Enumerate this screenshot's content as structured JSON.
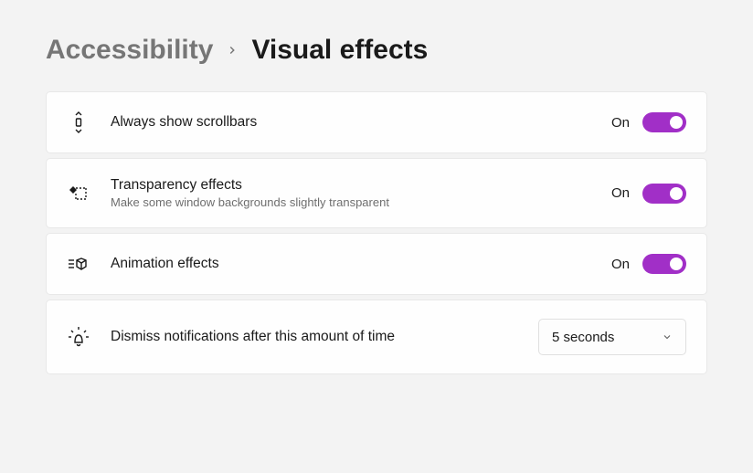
{
  "breadcrumb": {
    "parent": "Accessibility",
    "current": "Visual effects"
  },
  "settings": {
    "scrollbars": {
      "title": "Always show scrollbars",
      "state_label": "On"
    },
    "transparency": {
      "title": "Transparency effects",
      "description": "Make some window backgrounds slightly transparent",
      "state_label": "On"
    },
    "animation": {
      "title": "Animation effects",
      "state_label": "On"
    },
    "dismiss": {
      "title": "Dismiss notifications after this amount of time",
      "value": "5 seconds"
    }
  }
}
